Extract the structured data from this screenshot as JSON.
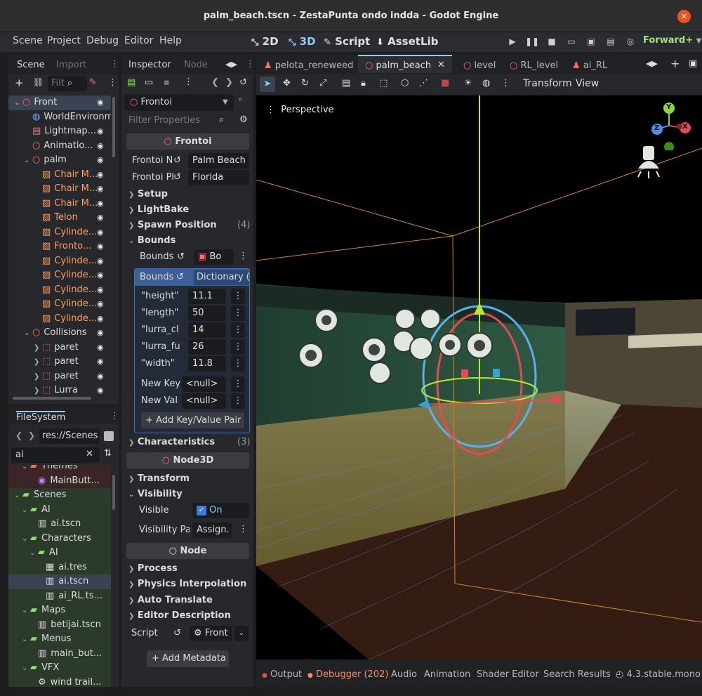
{
  "window": {
    "title": "palm_beach.tscn - ZestaPunta ondo indda - Godot Engine",
    "close": "✕"
  },
  "menu": [
    "Scene",
    "Project",
    "Debug",
    "Editor",
    "Help"
  ],
  "modes": {
    "m2d": "2D",
    "m3d": "3D",
    "script": "Script",
    "assetlib": "AssetLib"
  },
  "renderer": "Forward+",
  "scene_dock": {
    "tabs": [
      "Scene",
      "Import"
    ],
    "filter_placeholder": "Filt",
    "nodes": [
      {
        "label": "Front",
        "depth": 0,
        "kind": "root"
      },
      {
        "label": "WorldEnvironme",
        "depth": 1,
        "kind": "globe"
      },
      {
        "label": "Lightmap...",
        "depth": 1,
        "kind": "lightmap"
      },
      {
        "label": "Animatio...",
        "depth": 1,
        "kind": "node"
      },
      {
        "label": "palm",
        "depth": 1,
        "kind": "node"
      },
      {
        "label": "Chair M...",
        "depth": 2,
        "kind": "mesh"
      },
      {
        "label": "Chair M...",
        "depth": 2,
        "kind": "mesh"
      },
      {
        "label": "Chair M...",
        "depth": 2,
        "kind": "mesh"
      },
      {
        "label": "Telon",
        "depth": 2,
        "kind": "mesh"
      },
      {
        "label": "Cylinde...",
        "depth": 2,
        "kind": "mesh"
      },
      {
        "label": "Fronto...",
        "depth": 2,
        "kind": "mesh"
      },
      {
        "label": "Cylinde...",
        "depth": 2,
        "kind": "mesh"
      },
      {
        "label": "Cylinde...",
        "depth": 2,
        "kind": "mesh"
      },
      {
        "label": "Cylinde...",
        "depth": 2,
        "kind": "mesh"
      },
      {
        "label": "Cylinde...",
        "depth": 2,
        "kind": "mesh"
      },
      {
        "label": "Cylinde...",
        "depth": 2,
        "kind": "mesh"
      },
      {
        "label": "Collisions",
        "depth": 1,
        "kind": "node"
      },
      {
        "label": "paret",
        "depth": 2,
        "kind": "body"
      },
      {
        "label": "paret",
        "depth": 2,
        "kind": "body"
      },
      {
        "label": "paret",
        "depth": 2,
        "kind": "body"
      },
      {
        "label": "Lurra",
        "depth": 2,
        "kind": "body"
      }
    ]
  },
  "filesystem": {
    "title": "FileSystem",
    "path": "res://Scenes",
    "search": "ai",
    "items": [
      {
        "label": "Themes",
        "depth": 1,
        "kind": "folder-red"
      },
      {
        "label": "MainButt...",
        "depth": 2,
        "kind": "theme"
      },
      {
        "label": "Scenes",
        "depth": 0,
        "kind": "folder"
      },
      {
        "label": "AI",
        "depth": 1,
        "kind": "folder"
      },
      {
        "label": "ai.tscn",
        "depth": 2,
        "kind": "scene"
      },
      {
        "label": "Characters",
        "depth": 1,
        "kind": "folder"
      },
      {
        "label": "AI",
        "depth": 2,
        "kind": "folder"
      },
      {
        "label": "ai.tres",
        "depth": 3,
        "kind": "res"
      },
      {
        "label": "ai.tscn",
        "depth": 3,
        "kind": "scene"
      },
      {
        "label": "ai_RL.ts...",
        "depth": 3,
        "kind": "scene"
      },
      {
        "label": "Maps",
        "depth": 1,
        "kind": "folder"
      },
      {
        "label": "betijai.tscn",
        "depth": 2,
        "kind": "scene"
      },
      {
        "label": "Menus",
        "depth": 1,
        "kind": "folder"
      },
      {
        "label": "main_but...",
        "depth": 2,
        "kind": "scene"
      },
      {
        "label": "VFX",
        "depth": 1,
        "kind": "folder"
      },
      {
        "label": "wind trail...",
        "depth": 2,
        "kind": "gear"
      }
    ]
  },
  "inspector": {
    "tabs": [
      "Inspector",
      "Node"
    ],
    "object": "Frontoi",
    "filter_placeholder": "Filter Properties",
    "section1": "Frontoi",
    "prop_name_label": "Frontoi N",
    "prop_name_value": "Palm Beach",
    "prop_place_label": "Frontoi Pl",
    "prop_place_value": "Florida",
    "groups1": [
      "Setup",
      "LightBake"
    ],
    "spawn": "Spawn Position",
    "spawn_count": "(4)",
    "bounds_group": "Bounds",
    "bounds_label": "Bounds",
    "bounds_value": "Bo",
    "dict_label": "Bounds",
    "dict_value": "Dictionary (",
    "dict_entries": [
      {
        "key": "\"height\"",
        "value": "11.1"
      },
      {
        "key": "\"length\"",
        "value": "50"
      },
      {
        "key": "\"lurra_cl",
        "value": "14"
      },
      {
        "key": "\"lurra_fu",
        "value": "26"
      },
      {
        "key": "\"width\"",
        "value": "11.8"
      }
    ],
    "new_key_label": "New Key",
    "new_key_value": "<null>",
    "new_val_label": "New Val",
    "new_val_value": "<null>",
    "add_pair": "Add Key/Value Pair",
    "characteristics": "Characteristics",
    "characteristics_count": "(3)",
    "section2": "Node3D",
    "transform": "Transform",
    "visibility": "Visibility",
    "visible_label": "Visible",
    "visible_value": "On",
    "vis_parent_label": "Visibility Pa",
    "vis_parent_value": "Assign.",
    "section3": "Node",
    "groups3": [
      "Process",
      "Physics Interpolation",
      "Auto Translate",
      "Editor Description"
    ],
    "script_label": "Script",
    "script_value": "Front",
    "add_metadata": "Add Metadata"
  },
  "editor_tabs": [
    "pelota_reneweed",
    "palm_beach",
    "level",
    "RL_level",
    "ai_RL"
  ],
  "viewport_toolbar": {
    "transform": "Transform",
    "view": "View"
  },
  "viewport": {
    "label": "Perspective",
    "gizmo_axes": [
      "Y",
      "X",
      "Z"
    ]
  },
  "bottom_panel": [
    "Output",
    "Debugger (202)",
    "Audio",
    "Animation",
    "Shader Editor",
    "Search Results"
  ],
  "version": "4.3.stable.mono",
  "colors": {
    "accent": "#8ecbf5",
    "selection": "#4673b8",
    "renderer": "#a8e07a",
    "node_icon": "#ff6b6b",
    "mesh_icon": "#ff9e66"
  }
}
